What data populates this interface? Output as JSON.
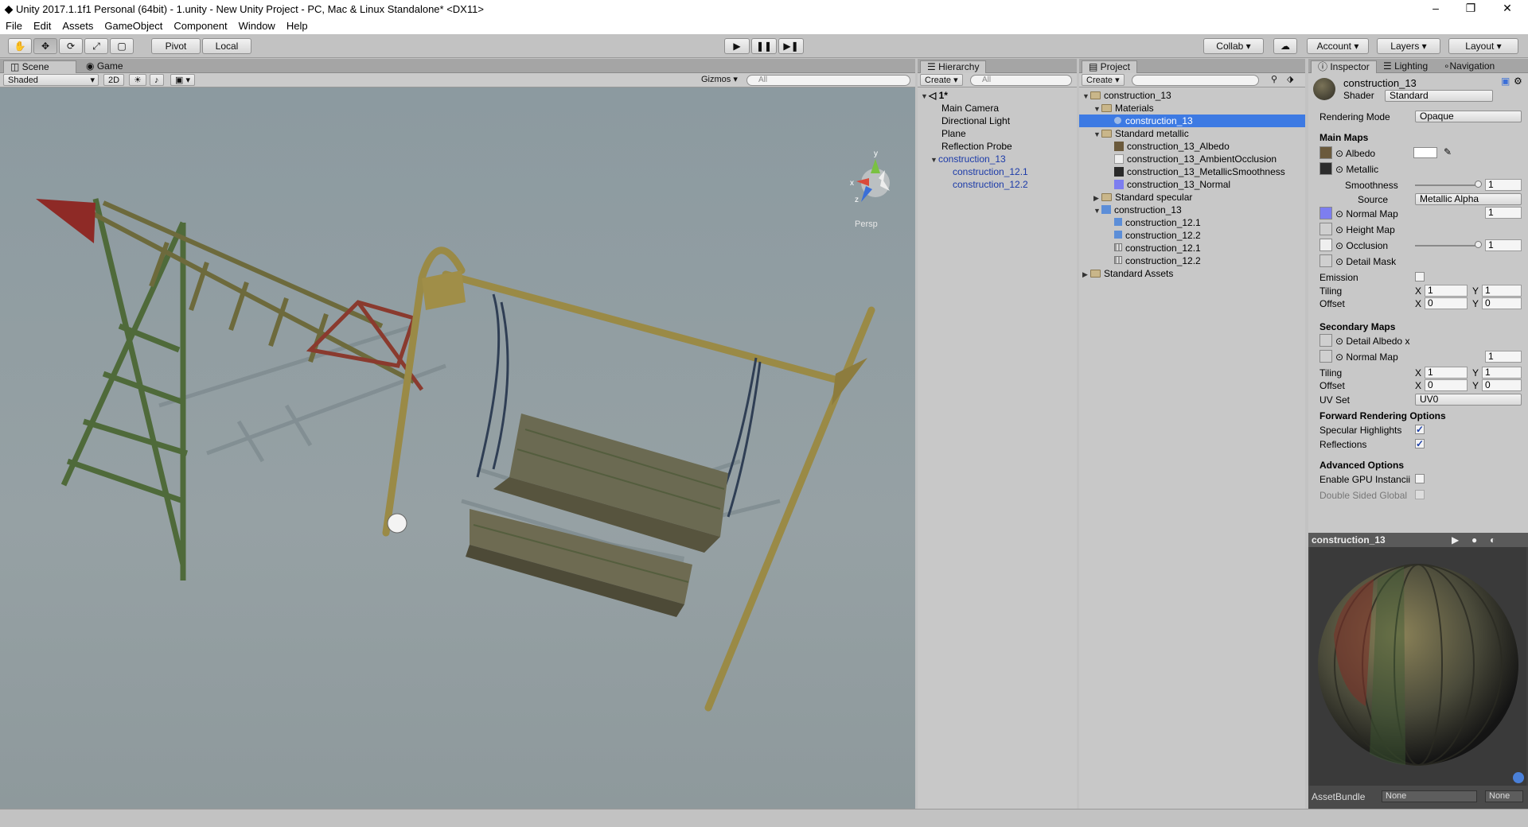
{
  "window": {
    "title": "Unity 2017.1.1f1 Personal (64bit) - 1.unity - New Unity Project - PC, Mac & Linux Standalone* <DX11>",
    "minimize": "–",
    "maximize": "❐",
    "close": "✕"
  },
  "menu": [
    "File",
    "Edit",
    "Assets",
    "GameObject",
    "Component",
    "Window",
    "Help"
  ],
  "toolbar": {
    "pivot": "Pivot",
    "local": "Local",
    "collab": "Collab",
    "account": "Account",
    "layers": "Layers",
    "layout": "Layout"
  },
  "scene": {
    "tabs": [
      "Scene",
      "Game"
    ],
    "shading": "Shaded",
    "mode2d": "2D",
    "gizmos": "Gizmos",
    "search_placeholder": "All",
    "persp": "Persp",
    "axis_y": "y",
    "axis_x": "x",
    "axis_z": "z"
  },
  "hierarchy": {
    "tab": "Hierarchy",
    "create": "Create",
    "search_placeholder": "All",
    "scene_name": "1*",
    "items": [
      "Main Camera",
      "Directional Light",
      "Plane",
      "Reflection Probe"
    ],
    "prefab_root": "construction_13",
    "prefab_children": [
      "construction_12.1",
      "construction_12.2"
    ]
  },
  "project": {
    "tab": "Project",
    "create": "Create",
    "root": "construction_13",
    "materials_folder": "Materials",
    "selected_material": "construction_13",
    "standard_metallic": "Standard metallic",
    "metallic_textures": [
      "construction_13_Albedo",
      "construction_13_AmbientOcclusion",
      "construction_13_MetallicSmoothness",
      "construction_13_Normal"
    ],
    "standard_specular": "Standard specular",
    "model": "construction_13",
    "model_children": [
      "construction_12.1",
      "construction_12.2",
      "construction_12.1",
      "construction_12.2"
    ],
    "standard_assets": "Standard Assets"
  },
  "inspector": {
    "tabs": [
      "Inspector",
      "Lighting",
      "Navigation"
    ],
    "material_name": "construction_13",
    "shader_label": "Shader",
    "shader_value": "Standard",
    "rendering_mode_label": "Rendering Mode",
    "rendering_mode_value": "Opaque",
    "main_maps": "Main Maps",
    "albedo": "Albedo",
    "metallic": "Metallic",
    "smoothness": "Smoothness",
    "smoothness_value": "1",
    "source": "Source",
    "source_value": "Metallic Alpha",
    "normal_map": "Normal Map",
    "normal_value": "1",
    "height_map": "Height Map",
    "occlusion": "Occlusion",
    "occlusion_value": "1",
    "detail_mask": "Detail Mask",
    "emission": "Emission",
    "tiling": "Tiling",
    "offset": "Offset",
    "x_label": "X",
    "y_label": "Y",
    "tiling_x": "1",
    "tiling_y": "1",
    "offset_x": "0",
    "offset_y": "0",
    "secondary_maps": "Secondary Maps",
    "detail_albedo": "Detail Albedo x",
    "sec_normal_map": "Normal Map",
    "sec_normal_value": "1",
    "sec_tiling_x": "1",
    "sec_tiling_y": "1",
    "sec_offset_x": "0",
    "sec_offset_y": "0",
    "uv_set": "UV Set",
    "uv_set_value": "UV0",
    "forward_rendering": "Forward Rendering Options",
    "specular_highlights": "Specular Highlights",
    "reflections": "Reflections",
    "advanced_options": "Advanced Options",
    "gpu_instancing": "Enable GPU Instancii",
    "double_sided": "Double Sided Global",
    "smoothness_fraction": 1.0,
    "occlusion_fraction": 1.0
  },
  "preview": {
    "title": "construction_13",
    "assetbundle_label": "AssetBundle",
    "assetbundle_value": "None",
    "variant_value": "None"
  },
  "colors": {
    "selection": "#3d7ae3",
    "prefab_text": "#1b3aa8",
    "scene_bg": "#8e9ea3"
  }
}
